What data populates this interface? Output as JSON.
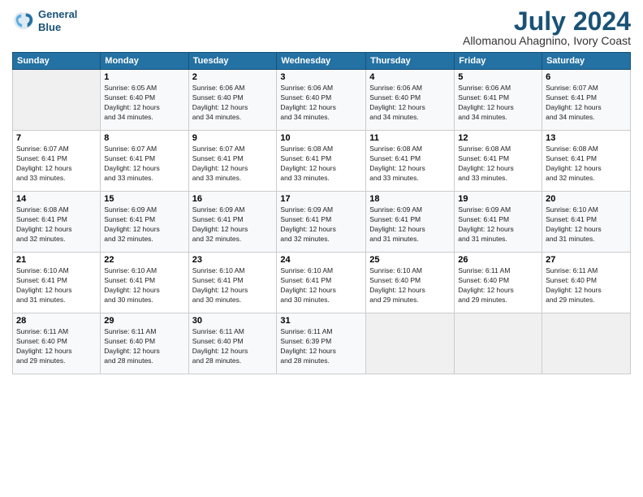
{
  "logo": {
    "line1": "General",
    "line2": "Blue"
  },
  "title": "July 2024",
  "subtitle": "Allomanou Ahagnino, Ivory Coast",
  "headers": [
    "Sunday",
    "Monday",
    "Tuesday",
    "Wednesday",
    "Thursday",
    "Friday",
    "Saturday"
  ],
  "weeks": [
    [
      {
        "day": "",
        "text": ""
      },
      {
        "day": "1",
        "text": "Sunrise: 6:05 AM\nSunset: 6:40 PM\nDaylight: 12 hours\nand 34 minutes."
      },
      {
        "day": "2",
        "text": "Sunrise: 6:06 AM\nSunset: 6:40 PM\nDaylight: 12 hours\nand 34 minutes."
      },
      {
        "day": "3",
        "text": "Sunrise: 6:06 AM\nSunset: 6:40 PM\nDaylight: 12 hours\nand 34 minutes."
      },
      {
        "day": "4",
        "text": "Sunrise: 6:06 AM\nSunset: 6:40 PM\nDaylight: 12 hours\nand 34 minutes."
      },
      {
        "day": "5",
        "text": "Sunrise: 6:06 AM\nSunset: 6:41 PM\nDaylight: 12 hours\nand 34 minutes."
      },
      {
        "day": "6",
        "text": "Sunrise: 6:07 AM\nSunset: 6:41 PM\nDaylight: 12 hours\nand 34 minutes."
      }
    ],
    [
      {
        "day": "7",
        "text": "Sunrise: 6:07 AM\nSunset: 6:41 PM\nDaylight: 12 hours\nand 33 minutes."
      },
      {
        "day": "8",
        "text": "Sunrise: 6:07 AM\nSunset: 6:41 PM\nDaylight: 12 hours\nand 33 minutes."
      },
      {
        "day": "9",
        "text": "Sunrise: 6:07 AM\nSunset: 6:41 PM\nDaylight: 12 hours\nand 33 minutes."
      },
      {
        "day": "10",
        "text": "Sunrise: 6:08 AM\nSunset: 6:41 PM\nDaylight: 12 hours\nand 33 minutes."
      },
      {
        "day": "11",
        "text": "Sunrise: 6:08 AM\nSunset: 6:41 PM\nDaylight: 12 hours\nand 33 minutes."
      },
      {
        "day": "12",
        "text": "Sunrise: 6:08 AM\nSunset: 6:41 PM\nDaylight: 12 hours\nand 33 minutes."
      },
      {
        "day": "13",
        "text": "Sunrise: 6:08 AM\nSunset: 6:41 PM\nDaylight: 12 hours\nand 32 minutes."
      }
    ],
    [
      {
        "day": "14",
        "text": "Sunrise: 6:08 AM\nSunset: 6:41 PM\nDaylight: 12 hours\nand 32 minutes."
      },
      {
        "day": "15",
        "text": "Sunrise: 6:09 AM\nSunset: 6:41 PM\nDaylight: 12 hours\nand 32 minutes."
      },
      {
        "day": "16",
        "text": "Sunrise: 6:09 AM\nSunset: 6:41 PM\nDaylight: 12 hours\nand 32 minutes."
      },
      {
        "day": "17",
        "text": "Sunrise: 6:09 AM\nSunset: 6:41 PM\nDaylight: 12 hours\nand 32 minutes."
      },
      {
        "day": "18",
        "text": "Sunrise: 6:09 AM\nSunset: 6:41 PM\nDaylight: 12 hours\nand 31 minutes."
      },
      {
        "day": "19",
        "text": "Sunrise: 6:09 AM\nSunset: 6:41 PM\nDaylight: 12 hours\nand 31 minutes."
      },
      {
        "day": "20",
        "text": "Sunrise: 6:10 AM\nSunset: 6:41 PM\nDaylight: 12 hours\nand 31 minutes."
      }
    ],
    [
      {
        "day": "21",
        "text": "Sunrise: 6:10 AM\nSunset: 6:41 PM\nDaylight: 12 hours\nand 31 minutes."
      },
      {
        "day": "22",
        "text": "Sunrise: 6:10 AM\nSunset: 6:41 PM\nDaylight: 12 hours\nand 30 minutes."
      },
      {
        "day": "23",
        "text": "Sunrise: 6:10 AM\nSunset: 6:41 PM\nDaylight: 12 hours\nand 30 minutes."
      },
      {
        "day": "24",
        "text": "Sunrise: 6:10 AM\nSunset: 6:41 PM\nDaylight: 12 hours\nand 30 minutes."
      },
      {
        "day": "25",
        "text": "Sunrise: 6:10 AM\nSunset: 6:40 PM\nDaylight: 12 hours\nand 29 minutes."
      },
      {
        "day": "26",
        "text": "Sunrise: 6:11 AM\nSunset: 6:40 PM\nDaylight: 12 hours\nand 29 minutes."
      },
      {
        "day": "27",
        "text": "Sunrise: 6:11 AM\nSunset: 6:40 PM\nDaylight: 12 hours\nand 29 minutes."
      }
    ],
    [
      {
        "day": "28",
        "text": "Sunrise: 6:11 AM\nSunset: 6:40 PM\nDaylight: 12 hours\nand 29 minutes."
      },
      {
        "day": "29",
        "text": "Sunrise: 6:11 AM\nSunset: 6:40 PM\nDaylight: 12 hours\nand 28 minutes."
      },
      {
        "day": "30",
        "text": "Sunrise: 6:11 AM\nSunset: 6:40 PM\nDaylight: 12 hours\nand 28 minutes."
      },
      {
        "day": "31",
        "text": "Sunrise: 6:11 AM\nSunset: 6:39 PM\nDaylight: 12 hours\nand 28 minutes."
      },
      {
        "day": "",
        "text": ""
      },
      {
        "day": "",
        "text": ""
      },
      {
        "day": "",
        "text": ""
      }
    ]
  ]
}
